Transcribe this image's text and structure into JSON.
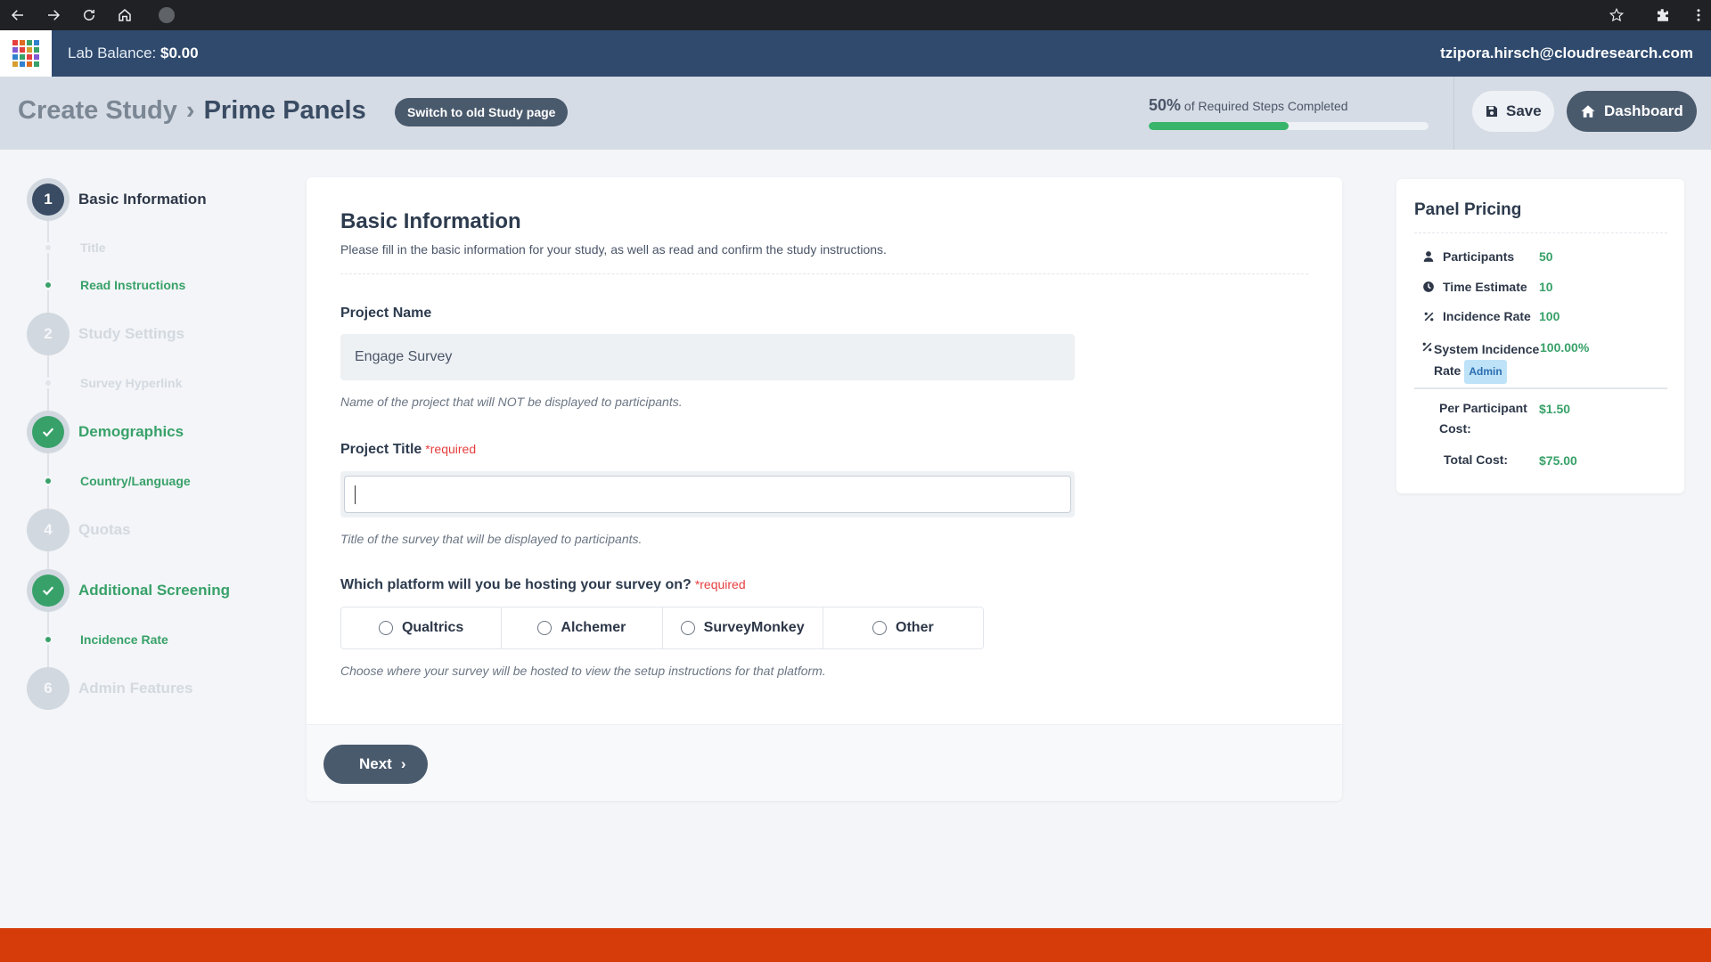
{
  "header": {
    "lab_balance_label": "Lab Balance:",
    "lab_balance_value": "$0.00",
    "user_email": "tzipora.hirsch@cloudresearch.com"
  },
  "subheader": {
    "crumb_1": "Create Study",
    "crumb_2": "Prime Panels",
    "old_study_button": "Switch to old Study page",
    "progress_percent_text": "50%",
    "progress_fraction": 0.5,
    "progress_caption": "of Required Steps Completed",
    "save_label": "Save",
    "dashboard_label": "Dashboard"
  },
  "stepper": {
    "steps": [
      {
        "number": "1",
        "label": "Basic Information",
        "state": "active"
      },
      {
        "number": "2",
        "label": "Study Settings",
        "state": "idle"
      },
      {
        "number": "",
        "label": "Demographics",
        "state": "done"
      },
      {
        "number": "4",
        "label": "Quotas",
        "state": "idle"
      },
      {
        "number": "",
        "label": "Additional Screening",
        "state": "done"
      },
      {
        "number": "6",
        "label": "Admin Features",
        "state": "idle"
      }
    ],
    "substeps": [
      {
        "label": "Title",
        "state": "idle"
      },
      {
        "label": "Read Instructions",
        "state": "done"
      },
      {
        "label": "Survey Hyperlink",
        "state": "idle"
      },
      {
        "label": "Country/Language",
        "state": "done"
      },
      {
        "label": "Incidence Rate",
        "state": "done"
      }
    ]
  },
  "form": {
    "title": "Basic Information",
    "description": "Please fill in the basic information for your study, as well as read and confirm the study instructions.",
    "project_name_label": "Project Name",
    "project_name_value": "Engage Survey",
    "project_name_hint": "Name of the project that will NOT be displayed to participants.",
    "project_title_label": "Project Title",
    "required_marker": "*required",
    "project_title_value": "",
    "project_title_hint": "Title of the survey that will be displayed to participants.",
    "platform_label": "Which platform will you be hosting your survey on?",
    "platforms": [
      "Qualtrics",
      "Alchemer",
      "SurveyMonkey",
      "Other"
    ],
    "platform_hint": "Choose where your survey will be hosted to view the setup instructions for that platform.",
    "next_label": "Next"
  },
  "pricing": {
    "title": "Panel Pricing",
    "participants_label": "Participants",
    "participants_value": "50",
    "time_label": "Time Estimate",
    "time_value": "10",
    "incidence_label": "Incidence Rate",
    "incidence_value": "100",
    "system_incidence_label_1": "System Incidence",
    "system_incidence_label_2": "Rate",
    "admin_badge": "Admin",
    "system_incidence_value": "100.00%",
    "per_participant_label_1": "Per Participant",
    "per_participant_label_2": "Cost:",
    "per_participant_value": "$1.50",
    "total_label": "Total Cost:",
    "total_value": "$75.00"
  },
  "colors": {
    "header_bg": "#2f4a6d",
    "accent_green": "#38a169",
    "dark_button": "#4a5a6d",
    "required_red": "#e53e3e",
    "bottom_strip": "#d63c0a"
  },
  "icons": {
    "back": "arrow-left-icon",
    "forward": "arrow-right-icon",
    "reload": "reload-icon",
    "home": "home-icon",
    "site": "globe-icon",
    "bookmark": "star-icon",
    "extensions": "puzzle-icon",
    "menu": "kebab-menu-icon",
    "save": "floppy-disk-icon",
    "dashboard": "home-icon",
    "next": "chevron-right-icon",
    "participants": "user-icon",
    "time": "clock-icon",
    "percent": "percent-icon"
  }
}
